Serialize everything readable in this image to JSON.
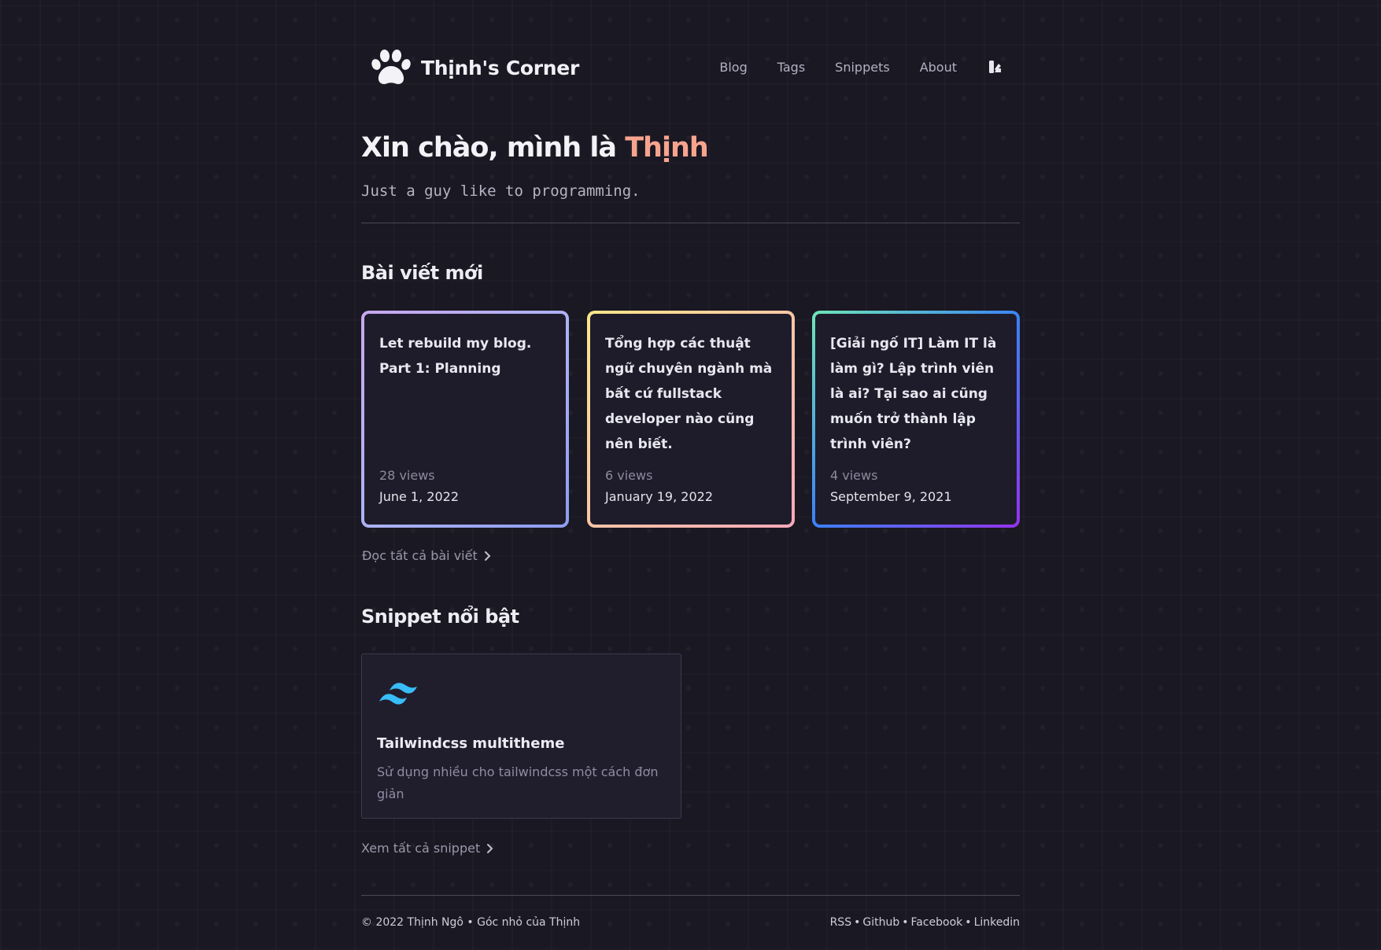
{
  "site": {
    "name": "Thịnh's Corner",
    "logo_icon": "paw-icon"
  },
  "nav": {
    "items": [
      {
        "label": "Blog"
      },
      {
        "label": "Tags"
      },
      {
        "label": "Snippets"
      },
      {
        "label": "About"
      }
    ],
    "theme_toggle_icon": "theme-palette-icon"
  },
  "hero": {
    "greeting": "Xin chào, mình là ",
    "name": "Thịnh",
    "name_color": "#f7a48f",
    "subtitle": "Just a guy like to programming."
  },
  "posts_section": {
    "title": "Bài viết mới",
    "posts": [
      {
        "title": "Let rebuild my blog. Part 1: Planning",
        "views": "28 views",
        "date": "June 1, 2022"
      },
      {
        "title": "Tổng hợp các thuật ngữ chuyên ngành mà bất cứ fullstack developer nào cũng nên biết.",
        "views": "6 views",
        "date": "January 19, 2022"
      },
      {
        "title": "[Giải ngố IT] Làm IT là làm gì? Lập trình viên là ai? Tại sao ai cũng muốn trở thành lập trình viên?",
        "views": "4 views",
        "date": "September 9, 2021"
      }
    ],
    "more_label": "Đọc tất cả bài viết"
  },
  "snippets_section": {
    "title": "Snippet nổi bật",
    "snippet": {
      "icon": "tailwindcss-icon",
      "title": "Tailwindcss multitheme",
      "description": "Sử dụng nhiều cho tailwindcss một cách đơn giản"
    },
    "more_label": "Xem tất cả snippet"
  },
  "footer": {
    "copyright": "© 2022 Thịnh Ngô • Góc nhỏ của Thịnh",
    "links": [
      {
        "label": "RSS"
      },
      {
        "label": "Github"
      },
      {
        "label": "Facebook"
      },
      {
        "label": "Linkedin"
      }
    ],
    "separator": "•"
  },
  "colors": {
    "background": "#1a1822",
    "accent": "#f7a48f",
    "card_bg": "#1e1c2a",
    "tailwind_cyan": "#38bdf8"
  }
}
